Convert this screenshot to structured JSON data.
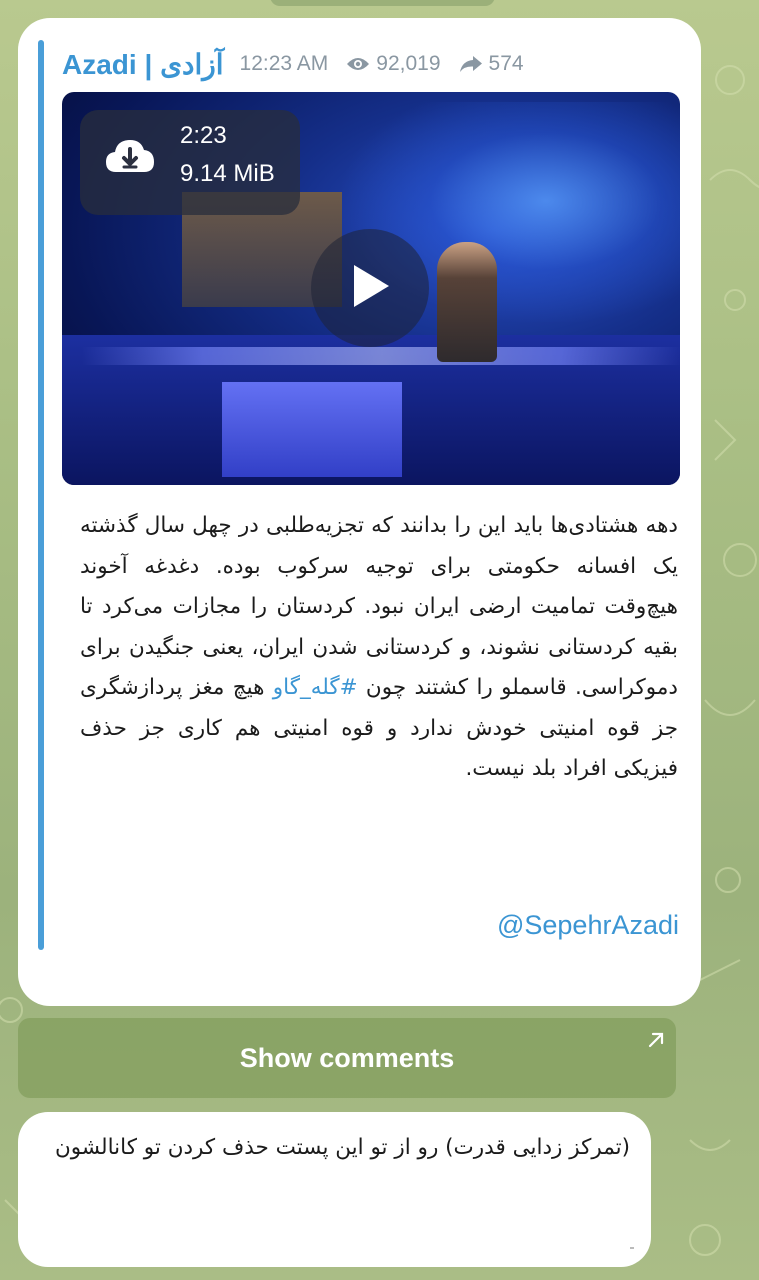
{
  "post": {
    "channel_name": "Azadi | آزادی",
    "time": "12:23 AM",
    "views": "92,019",
    "shares": "574",
    "video": {
      "duration": "2:23",
      "size": "9.14 MiB"
    },
    "text_part1": "دهه هشتادی‌ها باید این را بدانند که تجزیه‌طلبی در چهل سال گذشته یک افسانه حکومتی برای توجیه سرکوب بوده. دغدغه آخوند هیچ‌وقت تمامیت ارضی ایران نبود. کردستان را مجازات می‌کرد تا بقیه کردستانی نشوند، و کردستانی شدن ایران، یعنی جنگیدن برای دموکراسی. قاسملو را کشتند چون ",
    "hashtag": "#گله_گاو",
    "text_part2": " هیچ مغز پردازشگری جز قوه امنیتی خودش ندارد و قوه امنیتی هم کاری جز حذف فیزیکی افراد بلد نیست.",
    "signature": "@SepehrAzadi"
  },
  "comments_button": {
    "label": "Show comments"
  },
  "reply": {
    "text": "(تمرکز زدایی قدرت) رو از تو این پستت حذف کردن تو کانالشون"
  },
  "colors": {
    "accent": "#3b95d3",
    "background": "#a9be84",
    "bubble": "#ffffff"
  },
  "icons": [
    "eye-icon",
    "share-icon",
    "download-icon",
    "play-icon",
    "open-comments-icon"
  ]
}
